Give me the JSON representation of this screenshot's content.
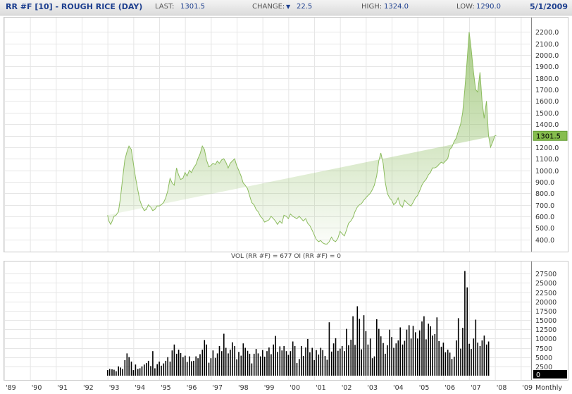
{
  "header": {
    "title": "RR #F [10] - ROUGH RICE (DAY)",
    "last_label": "LAST:",
    "last_value": "1301.5",
    "change_label": "CHANGE:",
    "change_icon": "down-triangle-icon",
    "change_value": "22.5",
    "high_label": "HIGH:",
    "high_value": "1324.0",
    "low_label": "LOW:",
    "low_value": "1290.0",
    "date": "5/1/2009"
  },
  "colors": {
    "price_line": "#8cbc5e",
    "price_fill": "#8cbc5e",
    "last_badge": "#86bd4e",
    "volume_bar": "#000000",
    "header_text": "#1d3f8f",
    "grid": "#e6e6e6"
  },
  "chart_data": [
    {
      "type": "area",
      "title": "",
      "ylim": [
        300,
        2300
      ],
      "yticks": [
        "400.0",
        "500.0",
        "600.0",
        "700.0",
        "800.0",
        "900.0",
        "1000.0",
        "1100.0",
        "1200.0",
        "1300.0",
        "1400.0",
        "1500.0",
        "1600.0",
        "1700.0",
        "1800.0",
        "1900.0",
        "2000.0",
        "2100.0",
        "2200.0"
      ],
      "last_label": "1301.5",
      "grid": true,
      "x": [
        1993.0,
        1993.05,
        1993.12,
        1993.18,
        1993.25,
        1993.33,
        1993.42,
        1993.5,
        1993.58,
        1993.67,
        1993.75,
        1993.83,
        1993.92,
        1994.0,
        1994.08,
        1994.17,
        1994.25,
        1994.33,
        1994.42,
        1994.5,
        1994.58,
        1994.67,
        1994.75,
        1994.83,
        1994.92,
        1995.0,
        1995.08,
        1995.17,
        1995.25,
        1995.33,
        1995.42,
        1995.5,
        1995.58,
        1995.67,
        1995.75,
        1995.83,
        1995.92,
        1996.0,
        1996.08,
        1996.17,
        1996.25,
        1996.33,
        1996.42,
        1996.5,
        1996.58,
        1996.67,
        1996.75,
        1996.83,
        1996.92,
        1997.0,
        1997.08,
        1997.17,
        1997.25,
        1997.33,
        1997.42,
        1997.5,
        1997.58,
        1997.67,
        1997.75,
        1997.83,
        1997.92,
        1998.0,
        1998.08,
        1998.17,
        1998.25,
        1998.33,
        1998.42,
        1998.5,
        1998.58,
        1998.67,
        1998.75,
        1998.83,
        1998.92,
        1999.0,
        1999.08,
        1999.17,
        1999.25,
        1999.33,
        1999.42,
        1999.5,
        1999.58,
        1999.67,
        1999.75,
        1999.83,
        1999.92,
        2000.0,
        2000.08,
        2000.17,
        2000.25,
        2000.33,
        2000.42,
        2000.5,
        2000.58,
        2000.67,
        2000.75,
        2000.83,
        2000.92,
        2001.0,
        2001.08,
        2001.17,
        2001.25,
        2001.33,
        2001.42,
        2001.5,
        2001.58,
        2001.67,
        2001.75,
        2001.83,
        2001.92,
        2002.0,
        2002.08,
        2002.17,
        2002.25,
        2002.33,
        2002.42,
        2002.5,
        2002.58,
        2002.67,
        2002.75,
        2002.83,
        2002.92,
        2003.0,
        2003.08,
        2003.17,
        2003.25,
        2003.33,
        2003.42,
        2003.5,
        2003.58,
        2003.67,
        2003.75,
        2003.83,
        2003.92,
        2004.0,
        2004.08,
        2004.17,
        2004.25,
        2004.33,
        2004.42,
        2004.5,
        2004.58,
        2004.67,
        2004.75,
        2004.83,
        2004.92,
        2005.0,
        2005.08,
        2005.17,
        2005.25,
        2005.33,
        2005.42,
        2005.5,
        2005.58,
        2005.67,
        2005.75,
        2005.83,
        2005.92,
        2006.0,
        2006.08,
        2006.17,
        2006.25,
        2006.33,
        2006.42,
        2006.5,
        2006.58,
        2006.67,
        2006.75,
        2006.83,
        2006.92,
        2007.0,
        2007.08,
        2007.17,
        2007.25,
        2007.33,
        2007.42,
        2007.5,
        2007.58,
        2007.67,
        2007.75,
        2007.83,
        2007.92,
        2008.0,
        2008.05,
        2008.1,
        2008.15,
        2008.2,
        2008.25,
        2008.3,
        2008.35,
        2008.42,
        2008.5,
        2008.58,
        2008.67,
        2008.75,
        2008.83,
        2008.92,
        2009.0,
        2009.08,
        2009.17,
        2009.25,
        2009.33
      ],
      "y": [
        610,
        560,
        530,
        560,
        600,
        610,
        640,
        760,
        920,
        1090,
        1160,
        1210,
        1180,
        1060,
        940,
        830,
        740,
        690,
        650,
        660,
        700,
        680,
        650,
        660,
        690,
        690,
        700,
        720,
        760,
        820,
        930,
        890,
        870,
        1020,
        960,
        920,
        930,
        980,
        950,
        1000,
        980,
        1020,
        1050,
        1100,
        1140,
        1210,
        1180,
        1090,
        1030,
        1040,
        1060,
        1050,
        1080,
        1060,
        1090,
        1100,
        1070,
        1020,
        1060,
        1080,
        1100,
        1040,
        1000,
        950,
        890,
        870,
        840,
        780,
        720,
        700,
        660,
        640,
        600,
        580,
        550,
        560,
        570,
        600,
        580,
        560,
        530,
        560,
        540,
        610,
        600,
        580,
        620,
        600,
        590,
        580,
        600,
        580,
        560,
        580,
        540,
        520,
        480,
        440,
        400,
        380,
        390,
        370,
        360,
        360,
        380,
        420,
        390,
        380,
        410,
        470,
        450,
        430,
        480,
        540,
        560,
        590,
        640,
        680,
        700,
        710,
        740,
        760,
        780,
        800,
        830,
        870,
        950,
        1080,
        1150,
        1060,
        900,
        800,
        760,
        740,
        700,
        720,
        760,
        700,
        680,
        740,
        720,
        700,
        690,
        720,
        760,
        780,
        820,
        870,
        900,
        920,
        960,
        980,
        1020,
        1020,
        1030,
        1050,
        1070,
        1060,
        1080,
        1100,
        1180,
        1200,
        1250,
        1280,
        1340,
        1400,
        1500,
        1700,
        1950,
        2200,
        2050,
        1850,
        1700,
        1680,
        1850,
        1600,
        1450,
        1600,
        1300,
        1200,
        1250,
        1300,
        1301.5
      ]
    },
    {
      "type": "bar",
      "title": "VOL (RR #F) = 677  OI (RR #F) = 0",
      "ylim": [
        0,
        30000
      ],
      "yticks": [
        "2500",
        "5000",
        "7500",
        "10000",
        "12500",
        "15000",
        "17500",
        "20000",
        "22500",
        "25000",
        "27500"
      ],
      "last_label": "0",
      "grid": true,
      "x": [
        1993.0,
        1993.08,
        1993.17,
        1993.25,
        1993.33,
        1993.42,
        1993.5,
        1993.58,
        1993.67,
        1993.75,
        1993.83,
        1993.92,
        1994.0,
        1994.08,
        1994.17,
        1994.25,
        1994.33,
        1994.42,
        1994.5,
        1994.58,
        1994.67,
        1994.75,
        1994.83,
        1994.92,
        1995.0,
        1995.08,
        1995.17,
        1995.25,
        1995.33,
        1995.42,
        1995.5,
        1995.58,
        1995.67,
        1995.75,
        1995.83,
        1995.92,
        1996.0,
        1996.08,
        1996.17,
        1996.25,
        1996.33,
        1996.42,
        1996.5,
        1996.58,
        1996.67,
        1996.75,
        1996.83,
        1996.92,
        1997.0,
        1997.08,
        1997.17,
        1997.25,
        1997.33,
        1997.42,
        1997.5,
        1997.58,
        1997.67,
        1997.75,
        1997.83,
        1997.92,
        1998.0,
        1998.08,
        1998.17,
        1998.25,
        1998.33,
        1998.42,
        1998.5,
        1998.58,
        1998.67,
        1998.75,
        1998.83,
        1998.92,
        1999.0,
        1999.08,
        1999.17,
        1999.25,
        1999.33,
        1999.42,
        1999.5,
        1999.58,
        1999.67,
        1999.75,
        1999.83,
        1999.92,
        2000.0,
        2000.08,
        2000.17,
        2000.25,
        2000.33,
        2000.42,
        2000.5,
        2000.58,
        2000.67,
        2000.75,
        2000.83,
        2000.92,
        2001.0,
        2001.08,
        2001.17,
        2001.25,
        2001.33,
        2001.42,
        2001.5,
        2001.58,
        2001.67,
        2001.75,
        2001.83,
        2001.92,
        2002.0,
        2002.08,
        2002.17,
        2002.25,
        2002.33,
        2002.42,
        2002.5,
        2002.58,
        2002.67,
        2002.75,
        2002.83,
        2002.92,
        2003.0,
        2003.08,
        2003.17,
        2003.25,
        2003.33,
        2003.42,
        2003.5,
        2003.58,
        2003.67,
        2003.75,
        2003.83,
        2003.92,
        2004.0,
        2004.08,
        2004.17,
        2004.25,
        2004.33,
        2004.42,
        2004.5,
        2004.58,
        2004.67,
        2004.75,
        2004.83,
        2004.92,
        2005.0,
        2005.08,
        2005.17,
        2005.25,
        2005.33,
        2005.42,
        2005.5,
        2005.58,
        2005.67,
        2005.75,
        2005.83,
        2005.92,
        2006.0,
        2006.08,
        2006.17,
        2006.25,
        2006.33,
        2006.42,
        2006.5,
        2006.58,
        2006.67,
        2006.75,
        2006.83,
        2006.92,
        2007.0,
        2007.08,
        2007.17,
        2007.25,
        2007.33,
        2007.42,
        2007.5,
        2007.58,
        2007.67,
        2007.75,
        2007.83,
        2007.92,
        2008.0,
        2008.08,
        2008.17,
        2008.25,
        2008.33,
        2008.42,
        2008.5,
        2008.58,
        2008.67,
        2008.75,
        2008.83,
        2008.92,
        2009.0,
        2009.08,
        2009.17,
        2009.25
      ],
      "values": [
        1500,
        1800,
        1700,
        1600,
        1200,
        2500,
        2200,
        1800,
        4200,
        6000,
        5000,
        3800,
        1500,
        3000,
        1800,
        2000,
        2500,
        3000,
        3400,
        4000,
        2600,
        6600,
        2000,
        3100,
        3800,
        2700,
        3300,
        4000,
        5000,
        3800,
        6800,
        8400,
        5900,
        7000,
        6100,
        5000,
        5400,
        3700,
        5200,
        3900,
        4000,
        5200,
        4700,
        5800,
        7000,
        9600,
        8400,
        3500,
        4700,
        6800,
        4800,
        6000,
        8000,
        6600,
        11300,
        7500,
        6000,
        7000,
        9000,
        8000,
        4400,
        6400,
        5400,
        8700,
        7500,
        6700,
        5900,
        3300,
        5900,
        7200,
        6000,
        5200,
        6900,
        5100,
        6600,
        7600,
        5800,
        8400,
        10700,
        6400,
        7900,
        6800,
        8000,
        6600,
        5600,
        6600,
        9200,
        8000,
        3400,
        4500,
        8000,
        5300,
        7600,
        9900,
        6300,
        7500,
        4200,
        6900,
        5700,
        7500,
        6900,
        5300,
        4300,
        14400,
        6500,
        8700,
        10100,
        6700,
        7300,
        8000,
        6600,
        12600,
        8200,
        9700,
        16000,
        8300,
        18700,
        15300,
        7100,
        16300,
        12000,
        8400,
        10000,
        4700,
        5200,
        15200,
        12600,
        10600,
        8800,
        5900,
        8200,
        12400,
        10400,
        7500,
        8700,
        9500,
        13000,
        8400,
        9400,
        12400,
        13600,
        10000,
        13400,
        11700,
        10000,
        12200,
        14600,
        16000,
        9800,
        14000,
        13300,
        10800,
        11200,
        15700,
        9300,
        7800,
        8900,
        6300,
        7000,
        6200,
        4500,
        5100,
        9500,
        15500,
        7300,
        12900,
        28200,
        23800,
        8600,
        7200,
        10000,
        15100,
        8900,
        8000,
        9500,
        10800,
        8400,
        9200
      ]
    }
  ],
  "xaxis": {
    "ticks": [
      "'89",
      "'90",
      "'91",
      "'92",
      "'93",
      "'94",
      "'95",
      "'96",
      "'97",
      "'98",
      "'99",
      "'00",
      "'01",
      "'02",
      "'03",
      "'04",
      "'05",
      "'06",
      "'07",
      "'08",
      "'09"
    ],
    "range": [
      1989.0,
      2009.4
    ],
    "period_label": "Monthly"
  }
}
